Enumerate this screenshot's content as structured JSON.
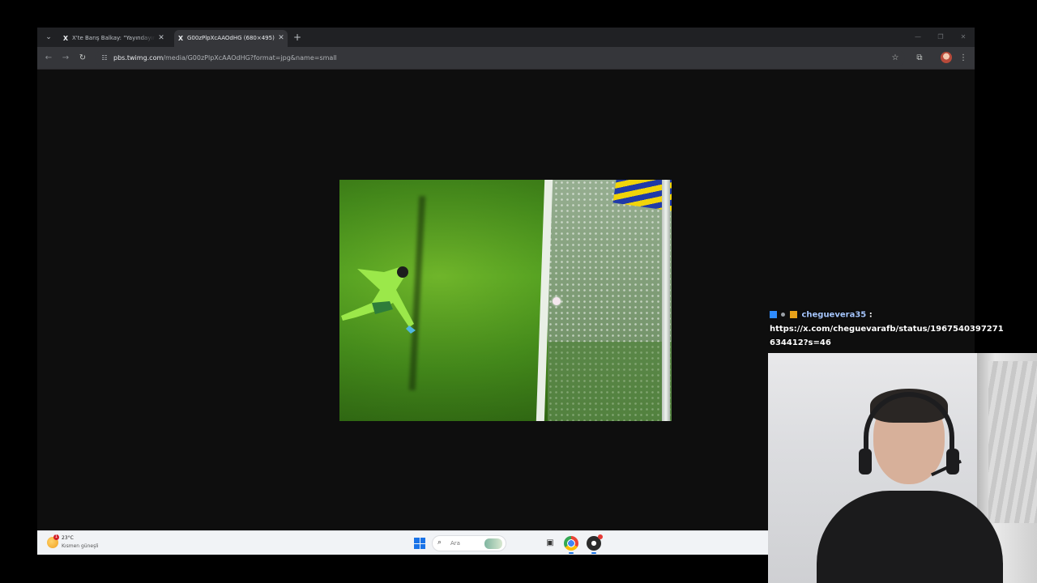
{
  "browser": {
    "tabs": [
      {
        "favicon": "X",
        "title": "X'te Barış Balkay: \"Yayındayım. G",
        "active": false
      },
      {
        "favicon": "X",
        "title": "G00zPlpXcAAOdHG (680×495)",
        "active": true
      }
    ],
    "url_host": "pbs.twimg.com",
    "url_path": "/media/G00zPlpXcAAOdHG?format=jpg&name=small"
  },
  "chat": {
    "username": "cheguevera35",
    "separator": " :",
    "message": "https://x.com/cheguevarafb/status/1967540397271634412?s=46"
  },
  "taskbar": {
    "weather_badge": "1",
    "temperature": "23°C",
    "condition": "Kısmen güneşli",
    "search_placeholder": "Ara"
  },
  "icons": {
    "tab_list": "chevron-down-icon",
    "tab_close": "close-icon",
    "new_tab": "plus-icon",
    "back": "arrow-left-icon",
    "forward": "arrow-right-icon",
    "reload": "reload-icon",
    "site_info": "tune-icon",
    "bookmark": "star-icon",
    "extensions": "puzzle-icon",
    "menu": "kebab-icon"
  },
  "colors": {
    "tab_strip": "#202124",
    "toolbar": "#35363a",
    "page_background": "#0e0e0e",
    "chat_username": "#a7c7ff",
    "taskbar": "#f1f3f6"
  }
}
